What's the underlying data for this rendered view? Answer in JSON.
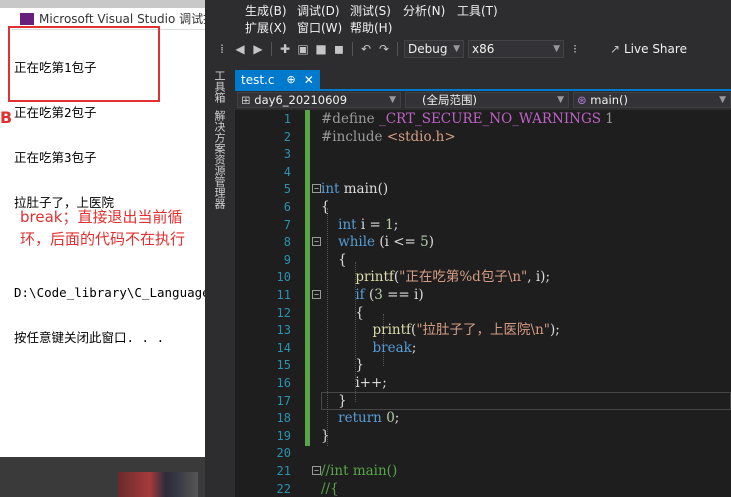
{
  "console": {
    "title": "Microsoft Visual Studio 调试控制",
    "output_lines": [
      "正在吃第1包子",
      "正在吃第2包子",
      "正在吃第3包子",
      "拉肚子了，上医院",
      "",
      "D:\\Code_library\\C_Language\\",
      "按任意键关闭此窗口. . ."
    ],
    "annotation_mark": "B",
    "annotation": "break；直接退出当前循环，后面的代码不在执行",
    "annotation_color": "#e03030"
  },
  "menu": {
    "build": "生成(B)",
    "debug": "调试(D)",
    "test": "测试(S)",
    "analyze": "分析(N)",
    "tools": "工具(T)",
    "extensions": "扩展(X)",
    "window": "窗口(W)",
    "help": "帮助(H)"
  },
  "toolbar": {
    "config": "Debug",
    "platform": "x86",
    "live_share": "Live Share"
  },
  "side_tabs": {
    "toolbox": "工具箱",
    "solution_explorer": "解决方案资源管理器"
  },
  "editor_tab": {
    "filename": "test.c",
    "pin": "⊕",
    "close": "✕"
  },
  "navbar": {
    "project": "day6_20210609",
    "scope": "(全局范围)",
    "function": "main()"
  },
  "code": {
    "line_numbers": [
      "1",
      "2",
      "3",
      "4",
      "5",
      "6",
      "7",
      "8",
      "9",
      "10",
      "11",
      "12",
      "13",
      "14",
      "15",
      "16",
      "17",
      "18",
      "19",
      "20",
      "21",
      "22"
    ],
    "lines": [
      [
        {
          "t": "#define ",
          "c": "pp"
        },
        {
          "t": "_CRT_SECURE_NO_WARNINGS",
          "c": "mac"
        },
        {
          "t": " 1",
          "c": "pp"
        }
      ],
      [
        {
          "t": "#include ",
          "c": "pp"
        },
        {
          "t": "<stdio.h>",
          "c": "str"
        }
      ],
      [],
      [],
      [
        {
          "t": "int",
          "c": "kw"
        },
        {
          "t": " main()",
          "c": ""
        }
      ],
      [
        {
          "t": "{",
          "c": ""
        }
      ],
      [
        {
          "t": "    int",
          "c": "kw"
        },
        {
          "t": " i = ",
          "c": ""
        },
        {
          "t": "1",
          "c": "num"
        },
        {
          "t": ";",
          "c": ""
        }
      ],
      [
        {
          "t": "    while",
          "c": "kw"
        },
        {
          "t": " (i <= ",
          "c": ""
        },
        {
          "t": "5",
          "c": "num"
        },
        {
          "t": ")",
          "c": ""
        }
      ],
      [
        {
          "t": "    {",
          "c": ""
        }
      ],
      [
        {
          "t": "        printf",
          "c": "fn"
        },
        {
          "t": "(",
          "c": ""
        },
        {
          "t": "\"正在吃第%d包子\\n\"",
          "c": "str"
        },
        {
          "t": ", i);",
          "c": ""
        }
      ],
      [
        {
          "t": "        if",
          "c": "kw"
        },
        {
          "t": " (",
          "c": ""
        },
        {
          "t": "3",
          "c": "num"
        },
        {
          "t": " == i)",
          "c": ""
        }
      ],
      [
        {
          "t": "        {",
          "c": ""
        }
      ],
      [
        {
          "t": "            printf",
          "c": "fn"
        },
        {
          "t": "(",
          "c": ""
        },
        {
          "t": "\"拉肚子了，上医院\\n\"",
          "c": "str"
        },
        {
          "t": ");",
          "c": ""
        }
      ],
      [
        {
          "t": "            break",
          "c": "kw"
        },
        {
          "t": ";",
          "c": ""
        }
      ],
      [
        {
          "t": "        }",
          "c": ""
        }
      ],
      [
        {
          "t": "        i++;",
          "c": ""
        }
      ],
      [
        {
          "t": "    }",
          "c": ""
        }
      ],
      [
        {
          "t": "    return",
          "c": "kw"
        },
        {
          "t": " ",
          "c": ""
        },
        {
          "t": "0",
          "c": "num"
        },
        {
          "t": ";",
          "c": ""
        }
      ],
      [
        {
          "t": "}",
          "c": ""
        }
      ],
      [],
      [
        {
          "t": "//int main()",
          "c": "com"
        }
      ],
      [
        {
          "t": "//{",
          "c": "com"
        }
      ]
    ]
  }
}
